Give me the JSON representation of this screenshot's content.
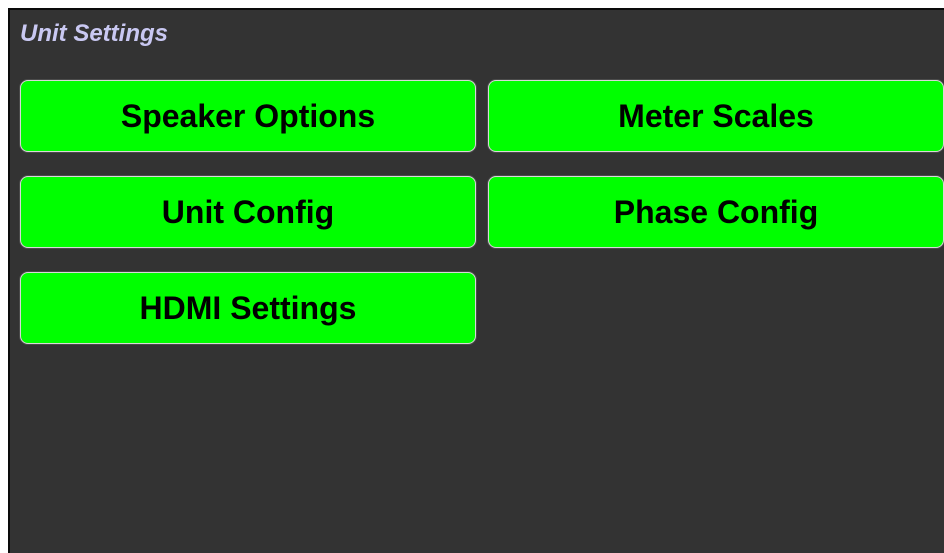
{
  "page": {
    "title": "Unit Settings"
  },
  "menu": {
    "speaker_options": "Speaker Options",
    "meter_scales": "Meter Scales",
    "unit_config": "Unit Config",
    "phase_config": "Phase Config",
    "hdmi_settings": "HDMI Settings"
  },
  "colors": {
    "background": "#333333",
    "title_text": "#c9c8f2",
    "button_fill": "#00ff00",
    "button_text": "#000000"
  }
}
